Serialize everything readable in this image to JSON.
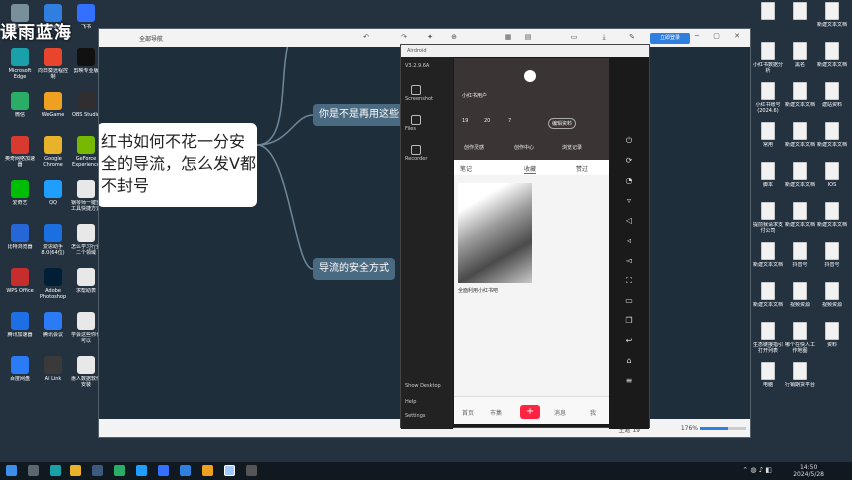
{
  "watermark": "课雨蓝海",
  "desktop": {
    "left_icons": [
      {
        "label": "回收站",
        "color": "#7a8f9c"
      },
      {
        "label": "ToDesk",
        "color": "#2f7fe0"
      },
      {
        "label": "飞书",
        "color": "#3370ff"
      },
      {
        "label": "Microsoft Edge",
        "color": "#1aa0a8"
      },
      {
        "label": "向日葵远程控制",
        "color": "#e8452c"
      },
      {
        "label": "剪映专业版",
        "color": "#111111"
      },
      {
        "label": "微信",
        "color": "#2aae67"
      },
      {
        "label": "WeGame",
        "color": "#f0a020"
      },
      {
        "label": "OBS Studio",
        "color": "#302e31"
      },
      {
        "label": "奥奇网络加速器",
        "color": "#d93a2f"
      },
      {
        "label": "Google Chrome",
        "color": "#e8b22a"
      },
      {
        "label": "GeForce Experience",
        "color": "#76b900"
      },
      {
        "label": "爱奇艺",
        "color": "#00be06"
      },
      {
        "label": "QQ",
        "color": "#1e9fff"
      },
      {
        "label": "钢琴师一键重工具快捷方式",
        "color": "#e8e8e8"
      },
      {
        "label": "比特浏览器",
        "color": "#2567d6"
      },
      {
        "label": "爱思助手8.0(64位)",
        "color": "#1b6fe0"
      },
      {
        "label": "怎么学习行业二个领域",
        "color": "#e8e8e8"
      },
      {
        "label": "WPS Office",
        "color": "#c62e2e"
      },
      {
        "label": "Adobe Photoshop",
        "color": "#001e36"
      },
      {
        "label": "求帮助表",
        "color": "#e8e8e8"
      },
      {
        "label": "腾讯加速器",
        "color": "#1e6fe6"
      },
      {
        "label": "腾讯会议",
        "color": "#2a7bf5"
      },
      {
        "label": "学会这些你也可以",
        "color": "#e8e8e8"
      },
      {
        "label": "百度网盘",
        "color": "#2a7bf5"
      },
      {
        "label": "Ai Link",
        "color": "#3a3a3a"
      },
      {
        "label": "惠人数据软件安装",
        "color": "#e8e8e8"
      }
    ],
    "right_icons": [
      {
        "label": ""
      },
      {
        "label": ""
      },
      {
        "label": "新建文本文档"
      },
      {
        "label": "小红书数据分析"
      },
      {
        "label": "黑名"
      },
      {
        "label": "新建文本文档"
      },
      {
        "label": "小红书账号(2024.6)"
      },
      {
        "label": "新建文本文档"
      },
      {
        "label": "建站资料"
      },
      {
        "label": "常用"
      },
      {
        "label": "新建文本文档"
      },
      {
        "label": "新建文本文档"
      },
      {
        "label": "脚本"
      },
      {
        "label": "新建文本文档"
      },
      {
        "label": "IOS"
      },
      {
        "label": "提前我请求支付公司"
      },
      {
        "label": "新建文本文档"
      },
      {
        "label": "新建文本文档"
      },
      {
        "label": "新建文本文档"
      },
      {
        "label": "抖音号"
      },
      {
        "label": "抖音号"
      },
      {
        "label": "新建文本文档"
      },
      {
        "label": "视频资源"
      },
      {
        "label": "视频资源"
      },
      {
        "label": "生态链接指引打开列表"
      },
      {
        "label": "哪个在快人工作地图"
      },
      {
        "label": "资料"
      },
      {
        "label": "电脑"
      },
      {
        "label": "行销期货平台"
      }
    ]
  },
  "window": {
    "title": "全部导航",
    "toolbar": [
      "撤销",
      "重做",
      "格式",
      "主题",
      "布局",
      "插入",
      "分享",
      "导出"
    ],
    "login_label": "立即登录",
    "zoom": "176%",
    "page": "主题 19"
  },
  "mindmap": {
    "root": "红书如何不花一分安全的导流，怎么发V都不封号",
    "children": [
      "你是不是再用这些",
      "导流的安全方式"
    ]
  },
  "mirror": {
    "title": "Airdroid",
    "version": "V3.2.9.6A",
    "sidebar": [
      "Screenshot",
      "Files",
      "Recorder"
    ],
    "bottom_items": [
      "Show Desktop",
      "Help",
      "Settings"
    ],
    "phone": {
      "username": "小红书用户",
      "stats": [
        "19",
        "20",
        "7"
      ],
      "stat_labels": [
        "关注",
        "粉丝",
        "获赞"
      ],
      "edit_label": "编辑资料",
      "actions": [
        "创作灵感",
        "创作中心",
        "浏览记录"
      ],
      "tabs": [
        "笔记",
        "收藏",
        "赞过"
      ],
      "active_tab": "收藏",
      "note_caption": "全面利用小红书吧",
      "nav": [
        "首页",
        "市集",
        "+",
        "消息",
        "我"
      ]
    }
  },
  "taskbar": {
    "time": "14:50",
    "date": "2024/5/28"
  }
}
